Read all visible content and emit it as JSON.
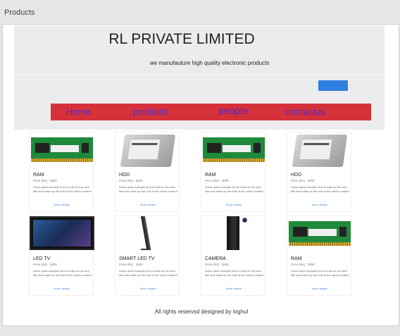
{
  "window": {
    "title": "Products"
  },
  "header": {
    "company": "RL PRIVATE LIMITED",
    "tagline": "we manufauture high quality electronic products"
  },
  "nav": {
    "items": [
      {
        "label": "Home"
      },
      {
        "label": "products"
      },
      {
        "label": "people"
      },
      {
        "label": "contactus"
      }
    ]
  },
  "products": [
    {
      "name": "RAM",
      "price": "Price (Rs) : 3000",
      "image": "ram-module-icon",
      "description": "Some quick example text to build on the card title and make up the bulk of the card's content.",
      "more": "More details"
    },
    {
      "name": "HDD",
      "price": "Price (Rs) : 3000",
      "image": "hard-drive-icon",
      "description": "Some quick example text to build on the card title and make up the bulk of the card's content.",
      "more": "More details"
    },
    {
      "name": "RAM",
      "price": "Price (Rs) : 3000",
      "image": "ram-module-icon",
      "description": "Some quick example text to build on the card title and make up the bulk of the card's content.",
      "more": "More details"
    },
    {
      "name": "HDD",
      "price": "Price (Rs) : 3000",
      "image": "hard-drive-icon",
      "description": "Some quick example text to build on the card title and make up the bulk of the card's content.",
      "more": "More details"
    },
    {
      "name": "LED TV",
      "price": "Price (Rs) : 3000",
      "image": "led-tv-icon",
      "description": "Some quick example text to build on the card title and make up the bulk of the card's content.",
      "more": "More details"
    },
    {
      "name": "SMART LED TV",
      "price": "Price (Rs) : 3000",
      "image": "smart-tv-icon",
      "description": "Some quick example text to build on the card title and make up the bulk of the card's content.",
      "more": "More details"
    },
    {
      "name": "CAMERA",
      "price": "Price (Rs) : 3000",
      "image": "camera-icon",
      "description": "Some quick example text to build on the card title and make up the bulk of the card's content.",
      "more": "More details"
    },
    {
      "name": "RAM",
      "price": "Price (Rs) : 3000",
      "image": "ram-module-icon",
      "description": "Some quick example text to build on the card title and make up the bulk of the card's content.",
      "more": "More details"
    }
  ],
  "footer": {
    "text": "All rights reservsd designed by loghul"
  },
  "colors": {
    "nav_bg": "#d5313a",
    "nav_text": "#4b2bd6",
    "button": "#2f7fe0",
    "header_bg": "#ececee"
  }
}
